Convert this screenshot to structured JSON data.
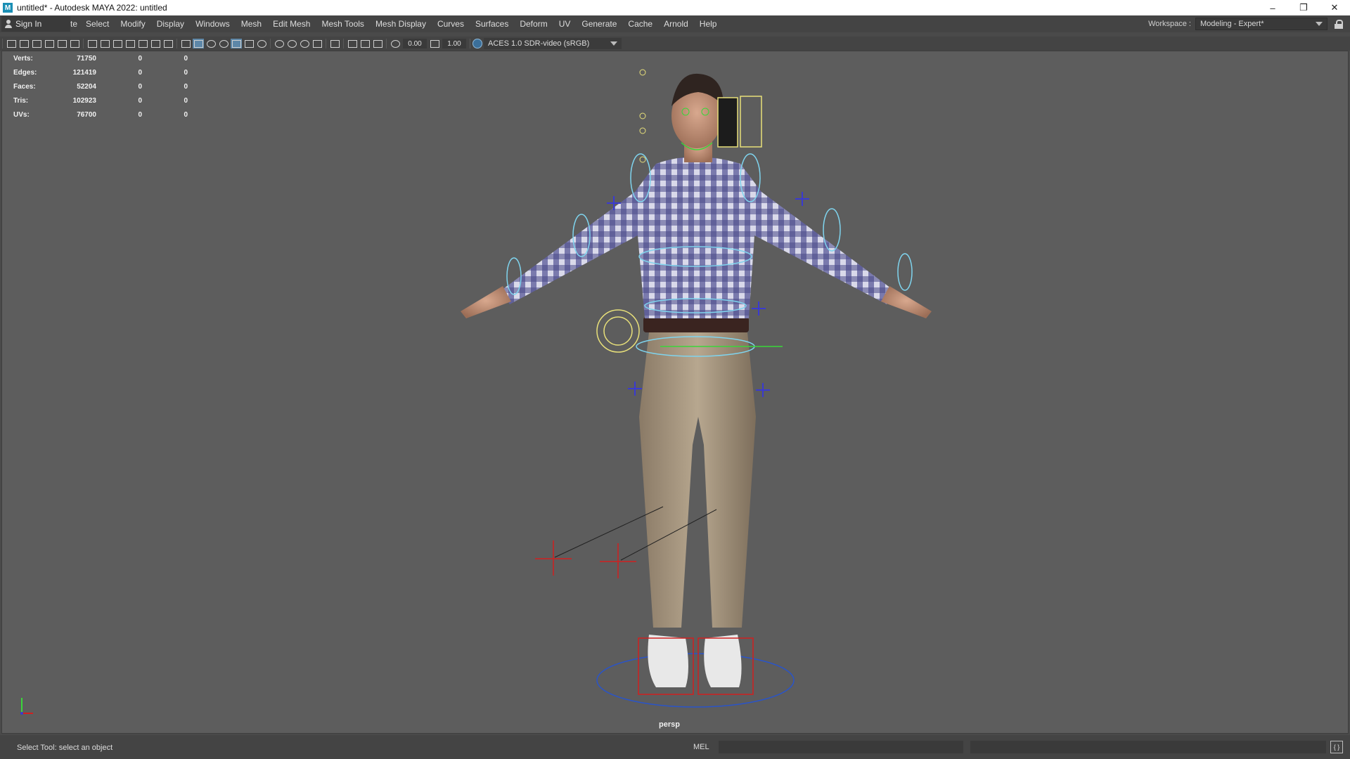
{
  "window": {
    "title": "untitled* - Autodesk MAYA 2022: untitled",
    "app_icon": "maya-icon",
    "controls": [
      "minimize-icon",
      "restore-icon",
      "close-icon"
    ]
  },
  "menubar": {
    "sign_in": "Sign In",
    "truncated_item": "te",
    "items": [
      "Select",
      "Modify",
      "Display",
      "Windows",
      "Mesh",
      "Edit Mesh",
      "Mesh Tools",
      "Mesh Display",
      "Curves",
      "Surfaces",
      "Deform",
      "UV",
      "Generate",
      "Cache",
      "Arnold",
      "Help"
    ],
    "workspace_label": "Workspace :",
    "workspace_value": "Modeling - Expert*"
  },
  "toolbar": {
    "field_1": "0.00",
    "field_2": "1.00",
    "color_management": "ACES 1.0 SDR-video (sRGB)"
  },
  "hud": {
    "rows": [
      {
        "label": "Verts:",
        "v1": "71750",
        "v2": "0",
        "v3": "0"
      },
      {
        "label": "Edges:",
        "v1": "121419",
        "v2": "0",
        "v3": "0"
      },
      {
        "label": "Faces:",
        "v1": "52204",
        "v2": "0",
        "v3": "0"
      },
      {
        "label": "Tris:",
        "v1": "102923",
        "v2": "0",
        "v3": "0"
      },
      {
        "label": "UVs:",
        "v1": "76700",
        "v2": "0",
        "v3": "0"
      }
    ]
  },
  "viewport": {
    "camera": "persp"
  },
  "statusbar": {
    "help_line": "Select Tool: select an object",
    "mel_label": "MEL"
  },
  "colors": {
    "ui_bg": "#444444",
    "viewport_bg": "#5d5d5d",
    "rig_cyan": "#7fd4ee",
    "rig_yellow": "#e8e07a",
    "rig_blue": "#3a3ad0",
    "rig_red": "#d02020"
  }
}
